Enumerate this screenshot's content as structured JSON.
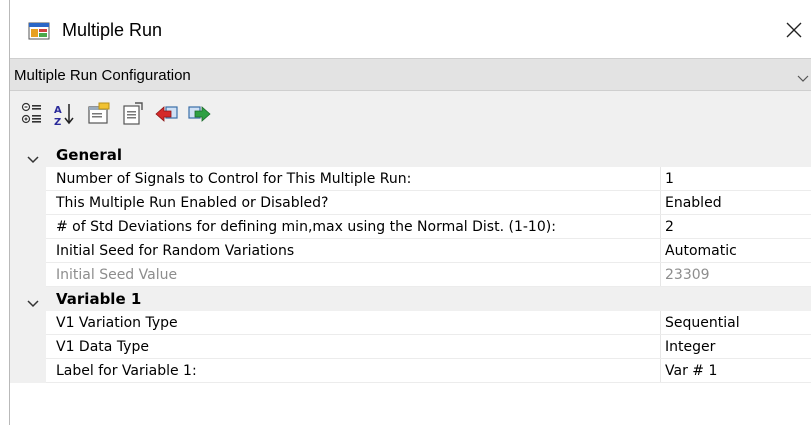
{
  "window": {
    "title": "Multiple Run",
    "icons": {
      "app": "app-window-icon",
      "close": "close-icon"
    }
  },
  "selector": {
    "value": "Multiple Run Configuration",
    "icon": "chevron-down-icon"
  },
  "toolbar": {
    "buttons": [
      {
        "name": "categorized-view-button",
        "icon": "categorized-icon"
      },
      {
        "name": "alphabetical-sort-button",
        "icon": "sort-az-icon"
      },
      {
        "name": "property-pages-button",
        "icon": "property-pages-icon"
      },
      {
        "name": "property-window-button",
        "icon": "property-window-icon"
      },
      {
        "name": "import-button",
        "icon": "import-red-arrow-icon"
      },
      {
        "name": "export-button",
        "icon": "export-green-arrow-icon"
      }
    ]
  },
  "grid": {
    "categories": [
      {
        "label": "General",
        "expanded": true,
        "properties": [
          {
            "name": "Number of Signals to Control for This Multiple Run:",
            "value": "1",
            "disabled": false
          },
          {
            "name": "This Multiple Run Enabled or Disabled?",
            "value": "Enabled",
            "disabled": false
          },
          {
            "name": "# of Std Deviations for defining min,max using the Normal Dist. (1-10):",
            "value": "2",
            "disabled": false
          },
          {
            "name": "Initial Seed for Random Variations",
            "value": "Automatic",
            "disabled": false
          },
          {
            "name": "Initial Seed Value",
            "value": "23309",
            "disabled": true
          }
        ]
      },
      {
        "label": "Variable 1",
        "expanded": true,
        "properties": [
          {
            "name": "V1 Variation Type",
            "value": "Sequential",
            "disabled": false
          },
          {
            "name": "V1 Data Type",
            "value": "Integer",
            "disabled": false
          },
          {
            "name": "Label for Variable 1:",
            "value": "Var # 1",
            "disabled": false
          }
        ]
      }
    ]
  },
  "colors": {
    "config_bar": "#e3e3e3",
    "toolbar": "#f0f0f0",
    "category_row": "#f0f0f0",
    "disabled_text": "#8d8d8d"
  }
}
